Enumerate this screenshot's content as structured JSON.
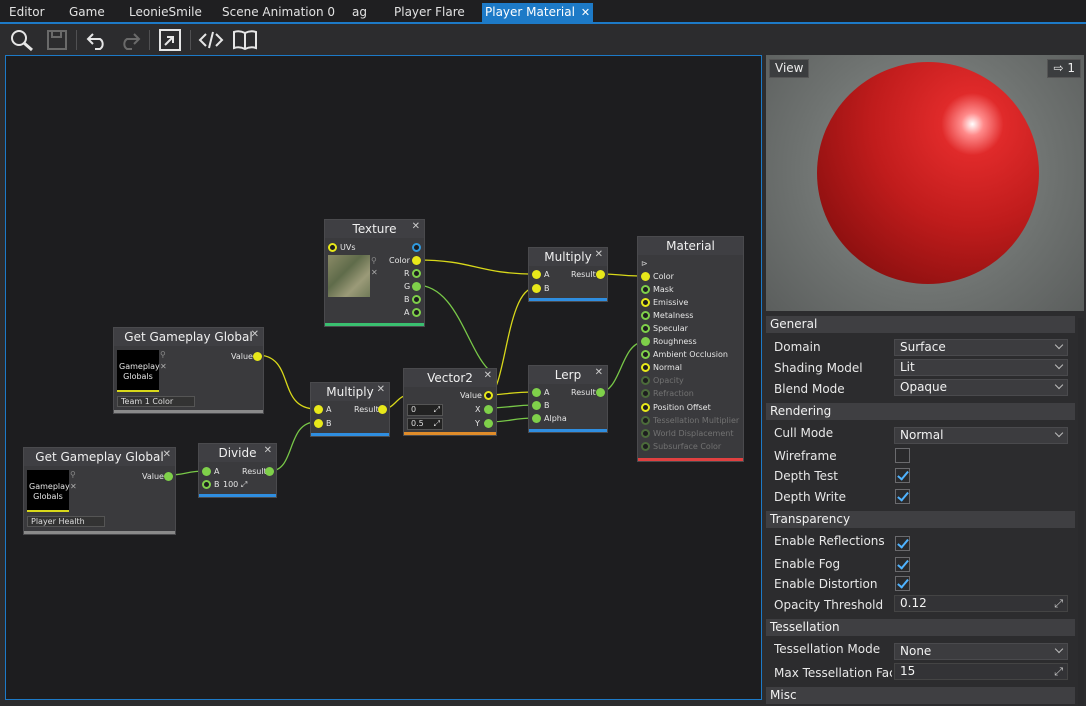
{
  "tabs": [
    {
      "label": "Editor"
    },
    {
      "label": "Game"
    },
    {
      "label": "LeonieSmile"
    },
    {
      "label": "Scene Animation 0"
    },
    {
      "label": "ag"
    },
    {
      "label": "Player Flare"
    },
    {
      "label": "Player Material",
      "active": true,
      "close": "✕"
    }
  ],
  "toolbar": {
    "icons": [
      "search-icon",
      "save-icon",
      "undo-icon",
      "redo-icon",
      "fit-view-icon",
      "source-code-icon",
      "docs-icon"
    ]
  },
  "graph": {
    "nodes": {
      "texture": {
        "title": "Texture",
        "uvs": "UVs",
        "color": "Color",
        "r": "R",
        "g": "G",
        "b": "B",
        "a": "A"
      },
      "multiply_top": {
        "title": "Multiply",
        "a": "A",
        "b": "B",
        "result": "Result"
      },
      "material": {
        "title": "Material",
        "inputs": [
          "Color",
          "Mask",
          "Emissive",
          "Metalness",
          "Specular",
          "Roughness",
          "Ambient Occlusion",
          "Normal",
          "Opacity",
          "Refraction",
          "Position Offset",
          "Tessellation Multiplier",
          "World Displacement",
          "Subsurface Color"
        ]
      },
      "get_global_1": {
        "title": "Get Gameplay Global",
        "value": "Value",
        "thumb": "Gameplay Globals",
        "select": "Team 1 Color"
      },
      "get_global_2": {
        "title": "Get Gameplay Global",
        "value": "Value",
        "thumb": "Gameplay Globals",
        "select": "Player Health"
      },
      "divide": {
        "title": "Divide",
        "a": "A",
        "b": "B",
        "b_value": "100",
        "result": "Result"
      },
      "multiply_mid": {
        "title": "Multiply",
        "a": "A",
        "b": "B",
        "result": "Result"
      },
      "vector2": {
        "title": "Vector2",
        "value": "Value",
        "x_in": "0",
        "y_in": "0.5",
        "x": "X",
        "y": "Y"
      },
      "lerp": {
        "title": "Lerp",
        "a": "A",
        "b": "B",
        "alpha": "Alpha",
        "result": "Result"
      }
    }
  },
  "preview": {
    "view_label": "View",
    "camera_label": "1"
  },
  "properties": {
    "general": {
      "header": "General",
      "domain_label": "Domain",
      "domain_value": "Surface",
      "shading_label": "Shading Model",
      "shading_value": "Lit",
      "blend_label": "Blend Mode",
      "blend_value": "Opaque"
    },
    "rendering": {
      "header": "Rendering",
      "cull_label": "Cull Mode",
      "cull_value": "Normal",
      "wireframe_label": "Wireframe",
      "wireframe": false,
      "depth_test_label": "Depth Test",
      "depth_test": true,
      "depth_write_label": "Depth Write",
      "depth_write": true
    },
    "transparency": {
      "header": "Transparency",
      "reflections_label": "Enable Reflections",
      "reflections": true,
      "fog_label": "Enable Fog",
      "fog": true,
      "distortion_label": "Enable Distortion",
      "distortion": true,
      "opacity_label": "Opacity Threshold",
      "opacity_value": "0.12"
    },
    "tessellation": {
      "header": "Tessellation",
      "mode_label": "Tessellation Mode",
      "mode_value": "None",
      "max_label": "Max Tessellation Fact",
      "max_value": "15"
    },
    "misc": {
      "header": "Misc"
    }
  },
  "colors": {
    "accent": "#1d7ac7",
    "port_yellow": "#e8e81a",
    "port_green": "#7fd04a",
    "sphere_red": "#d42020"
  }
}
